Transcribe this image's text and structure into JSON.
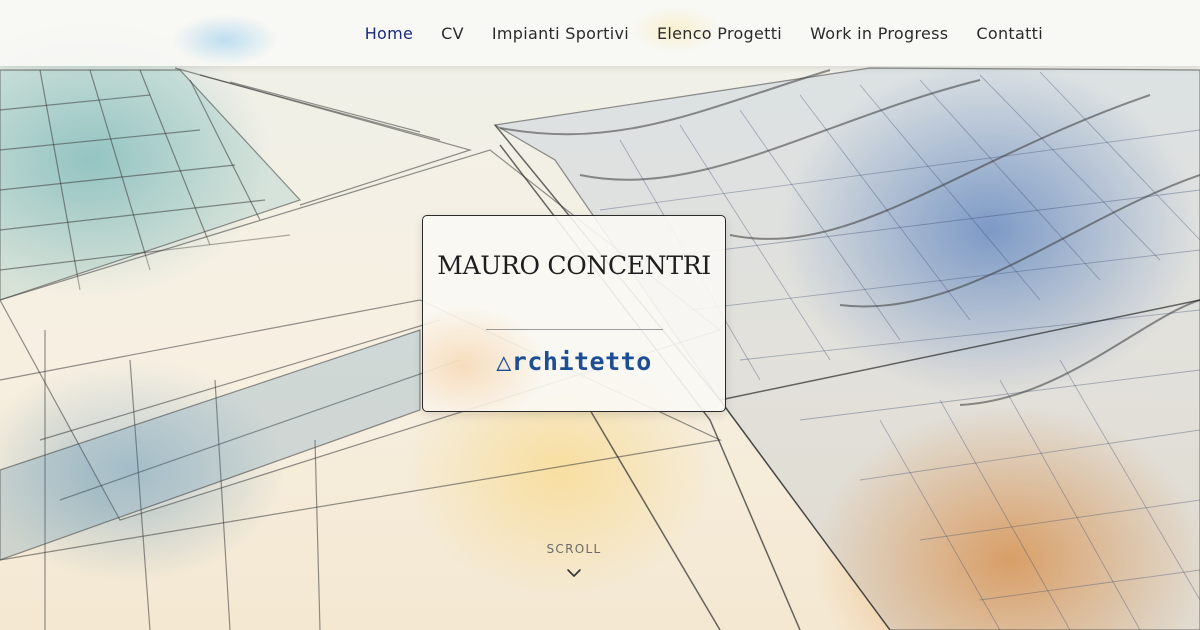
{
  "nav": {
    "items": [
      {
        "label": "Home",
        "active": true
      },
      {
        "label": "CV",
        "active": false
      },
      {
        "label": "Impianti Sportivi",
        "active": false
      },
      {
        "label": "Elenco Progetti",
        "active": false
      },
      {
        "label": "Work in Progress",
        "active": false
      },
      {
        "label": "Contatti",
        "active": false
      }
    ]
  },
  "hero": {
    "name": "MAURO CONCENTRI",
    "profession": "△rchitetto",
    "scroll_label": "SCROLL",
    "scroll_icon": "chevron-down-icon",
    "background": "architectural-sketch-illustration"
  },
  "colors": {
    "nav_active": "#1b2a7a",
    "nav_text": "#2b2b2b",
    "profession": "#1d4d95",
    "card_border": "#2a2a2a"
  }
}
